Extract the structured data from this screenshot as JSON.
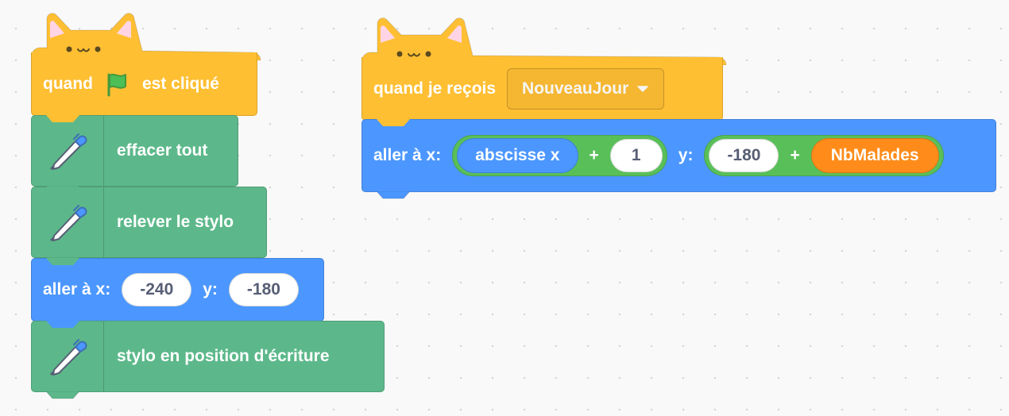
{
  "script1": {
    "hat": {
      "prefix": "quand",
      "icon": "green-flag-icon",
      "suffix": "est cliqué"
    },
    "clear_label": "effacer tout",
    "pen_up_label": "relever le stylo",
    "goto": {
      "label": "aller à x:",
      "x_value": "-240",
      "y_label": "y:",
      "y_value": "-180"
    },
    "pen_down_label": "stylo en position d'écriture"
  },
  "script2": {
    "hat": {
      "label": "quand je reçois",
      "message": "NouveauJour"
    },
    "goto": {
      "label": "aller à x:",
      "x_var": "abscisse x",
      "x_op": "+",
      "x_num": "1",
      "y_label": "y:",
      "y_num": "-180",
      "y_op": "+",
      "y_var": "NbMalades"
    }
  },
  "colors": {
    "event": "#ffbf33",
    "pen": "#5cb88a",
    "motion": "#4c97ff",
    "operator": "#59c059",
    "variable": "#ff8c1a"
  }
}
